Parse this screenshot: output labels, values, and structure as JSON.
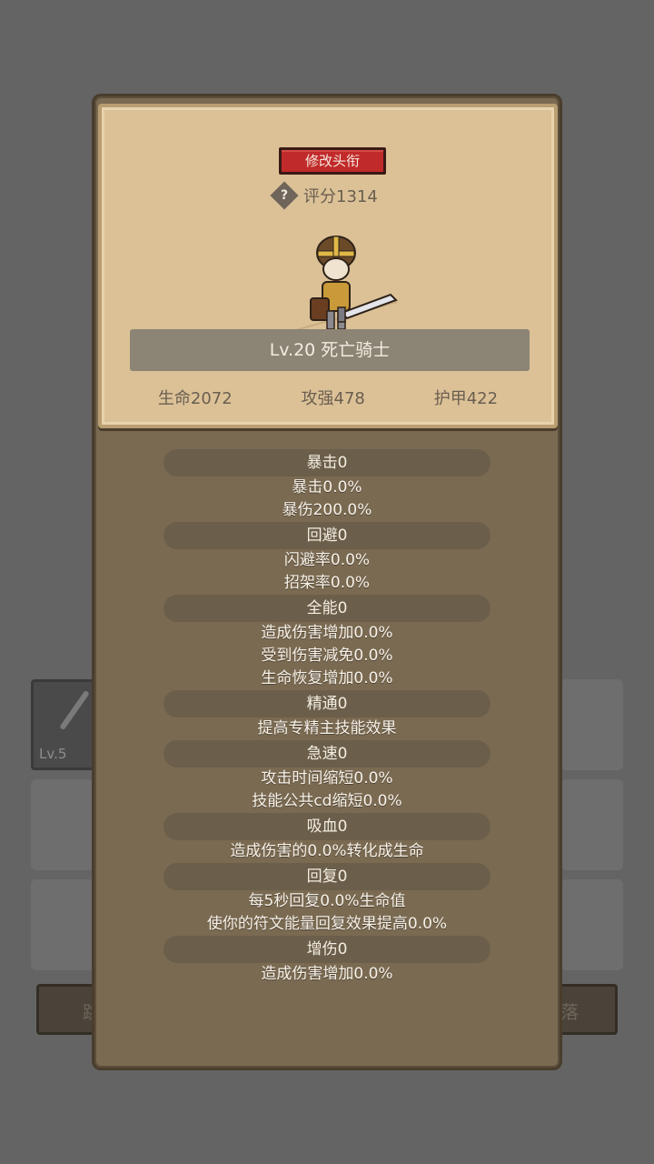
{
  "background": {
    "item_level": "Lv.5",
    "bar_left_text": "跳",
    "bar_right_text": "落"
  },
  "panel": {
    "rename_button": "修改头衔",
    "help_icon": "?",
    "score": "评分1314",
    "character_title": "Lv.20 死亡骑士",
    "stats": {
      "hp": "生命2072",
      "attack": "攻强478",
      "armor": "护甲422"
    },
    "attributes": [
      {
        "header": "暴击0",
        "lines": [
          "暴击0.0%",
          "暴伤200.0%"
        ]
      },
      {
        "header": "回避0",
        "lines": [
          "闪避率0.0%",
          "招架率0.0%"
        ]
      },
      {
        "header": "全能0",
        "lines": [
          "造成伤害增加0.0%",
          "受到伤害减免0.0%",
          "生命恢复增加0.0%"
        ]
      },
      {
        "header": "精通0",
        "lines": [
          "提高专精主技能效果"
        ]
      },
      {
        "header": "急速0",
        "lines": [
          "攻击时间缩短0.0%",
          "技能公共cd缩短0.0%"
        ]
      },
      {
        "header": "吸血0",
        "lines": [
          "造成伤害的0.0%转化成生命"
        ]
      },
      {
        "header": "回复0",
        "lines": [
          "每5秒回复0.0%生命值",
          "使你的符文能量回复效果提高0.0%"
        ]
      },
      {
        "header": "增伤0",
        "lines": [
          "造成伤害增加0.0%"
        ]
      }
    ]
  },
  "colors": {
    "parchment": "#dcc197",
    "panel_brown": "#7a6a52",
    "button_red": "#c12a2a"
  }
}
